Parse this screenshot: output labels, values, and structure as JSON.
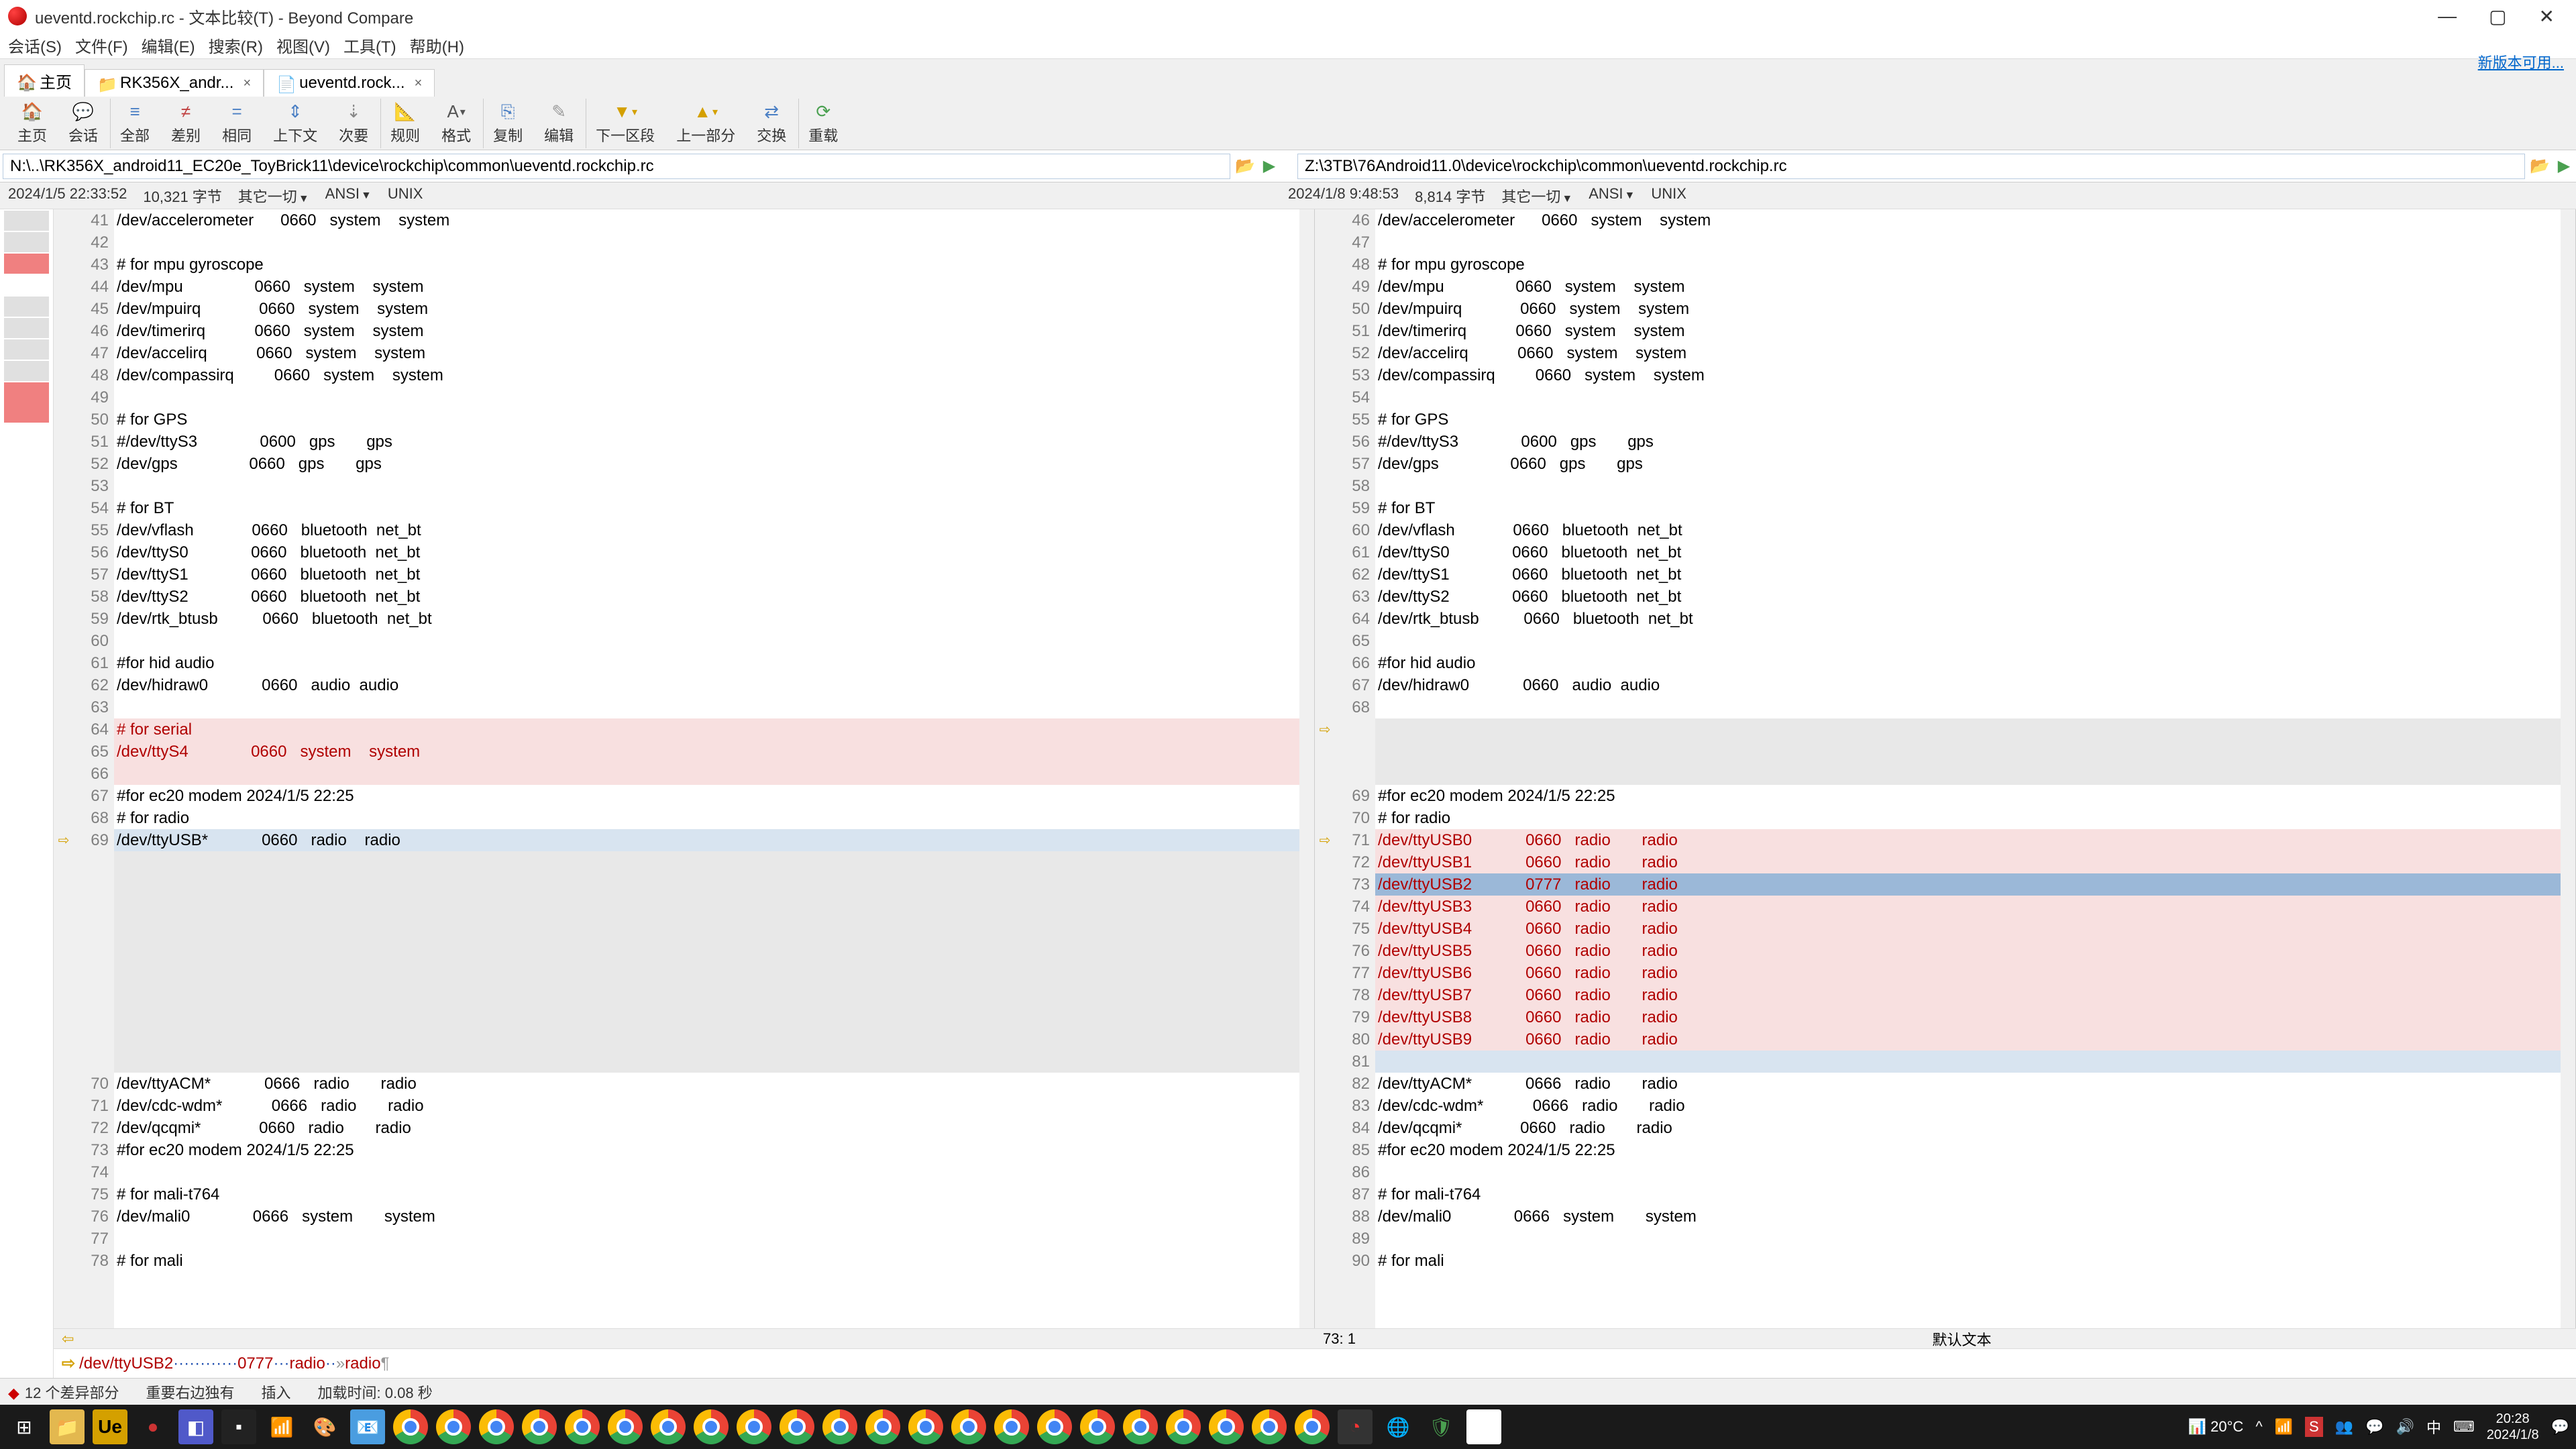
{
  "title": "ueventd.rockchip.rc - 文本比较(T) - Beyond Compare",
  "newversion": "新版本可用...",
  "menu": [
    "会话(S)",
    "文件(F)",
    "编辑(E)",
    "搜索(R)",
    "视图(V)",
    "工具(T)",
    "帮助(H)"
  ],
  "tabs": [
    {
      "label": "主页",
      "icon": "🏠"
    },
    {
      "label": "RK356X_andr...",
      "icon": "📁"
    },
    {
      "label": "ueventd.rock...",
      "icon": "📄"
    }
  ],
  "toolbar": [
    {
      "label": "主页",
      "icon": "🏠",
      "color": "#d4a000"
    },
    {
      "label": "会话",
      "icon": "💬",
      "color": "#d4a000"
    },
    {
      "label": "全部",
      "icon": "≡",
      "color": "#4a7fc4"
    },
    {
      "label": "差别",
      "icon": "≠",
      "color": "#c04040"
    },
    {
      "label": "相同",
      "icon": "=",
      "color": "#4a7fc4"
    },
    {
      "label": "上下文",
      "icon": "⇕",
      "color": "#4a7fc4"
    },
    {
      "label": "次要",
      "icon": "⇣",
      "color": "#888"
    },
    {
      "label": "规则",
      "icon": "📐",
      "color": "#d4a000"
    },
    {
      "label": "格式",
      "icon": "A",
      "color": "#555"
    },
    {
      "label": "复制",
      "icon": "⎘",
      "color": "#4a7fc4"
    },
    {
      "label": "编辑",
      "icon": "✎",
      "color": "#999"
    },
    {
      "label": "下一区段",
      "icon": "▼",
      "color": "#d4a000"
    },
    {
      "label": "上一部分",
      "icon": "▲",
      "color": "#d4a000"
    },
    {
      "label": "交换",
      "icon": "⇄",
      "color": "#4a7fc4"
    },
    {
      "label": "重载",
      "icon": "⟳",
      "color": "#4aa050"
    }
  ],
  "left_path": "N:\\..\\RK356X_android11_EC20e_ToyBrick11\\device\\rockchip\\common\\ueventd.rockchip.rc",
  "right_path": "Z:\\3TB\\76Android11.0\\device\\rockchip\\common\\ueventd.rockchip.rc",
  "left_status": {
    "time": "2024/1/5 22:33:52",
    "size": "10,321 字节",
    "all": "其它一切",
    "enc": "ANSI",
    "eol": "UNIX"
  },
  "right_status": {
    "time": "2024/1/8 9:48:53",
    "size": "8,814 字节",
    "all": "其它一切",
    "enc": "ANSI",
    "eol": "UNIX"
  },
  "left_lines": [
    {
      "n": 41,
      "t": "/dev/accelerometer      0660   system    system"
    },
    {
      "n": 42,
      "t": ""
    },
    {
      "n": 43,
      "t": "# for mpu gyroscope"
    },
    {
      "n": 44,
      "t": "/dev/mpu                0660   system    system"
    },
    {
      "n": 45,
      "t": "/dev/mpuirq             0660   system    system"
    },
    {
      "n": 46,
      "t": "/dev/timerirq           0660   system    system"
    },
    {
      "n": 47,
      "t": "/dev/accelirq           0660   system    system"
    },
    {
      "n": 48,
      "t": "/dev/compassirq         0660   system    system"
    },
    {
      "n": 49,
      "t": ""
    },
    {
      "n": 50,
      "t": "# for GPS"
    },
    {
      "n": 51,
      "t": "#/dev/ttyS3              0600   gps       gps"
    },
    {
      "n": 52,
      "t": "/dev/gps                0660   gps       gps"
    },
    {
      "n": 53,
      "t": ""
    },
    {
      "n": 54,
      "t": "# for BT"
    },
    {
      "n": 55,
      "t": "/dev/vflash             0660   bluetooth  net_bt"
    },
    {
      "n": 56,
      "t": "/dev/ttyS0              0660   bluetooth  net_bt"
    },
    {
      "n": 57,
      "t": "/dev/ttyS1              0660   bluetooth  net_bt"
    },
    {
      "n": 58,
      "t": "/dev/ttyS2              0660   bluetooth  net_bt"
    },
    {
      "n": 59,
      "t": "/dev/rtk_btusb          0660   bluetooth  net_bt"
    },
    {
      "n": 60,
      "t": ""
    },
    {
      "n": 61,
      "t": "#for hid audio"
    },
    {
      "n": 62,
      "t": "/dev/hidraw0            0660   audio  audio"
    },
    {
      "n": 63,
      "t": ""
    },
    {
      "n": 64,
      "t": "# for serial",
      "cls": "diff-red"
    },
    {
      "n": 65,
      "t": "/dev/ttyS4              0660   system    system",
      "cls": "diff-red"
    },
    {
      "n": 66,
      "t": "",
      "cls": "diff-red"
    },
    {
      "n": 67,
      "t": "#for ec20 modem 2024/1/5 22:25"
    },
    {
      "n": 68,
      "t": "# for radio"
    },
    {
      "n": 69,
      "t": "/dev/ttyUSB*            0660   radio    radio",
      "cls": "diff-blue",
      "marker": "⇨"
    },
    {
      "n": 0,
      "t": "",
      "cls": "diff-missing"
    },
    {
      "n": 0,
      "t": "",
      "cls": "diff-missing"
    },
    {
      "n": 0,
      "t": "",
      "cls": "diff-missing"
    },
    {
      "n": 0,
      "t": "",
      "cls": "diff-missing"
    },
    {
      "n": 0,
      "t": "",
      "cls": "diff-missing"
    },
    {
      "n": 0,
      "t": "",
      "cls": "diff-missing"
    },
    {
      "n": 0,
      "t": "",
      "cls": "diff-missing"
    },
    {
      "n": 0,
      "t": "",
      "cls": "diff-missing"
    },
    {
      "n": 0,
      "t": "",
      "cls": "diff-missing"
    },
    {
      "n": 0,
      "t": "",
      "cls": "diff-missing"
    },
    {
      "n": 70,
      "t": "/dev/ttyACM*            0666   radio       radio"
    },
    {
      "n": 71,
      "t": "/dev/cdc-wdm*           0666   radio       radio"
    },
    {
      "n": 72,
      "t": "/dev/qcqmi*             0660   radio       radio"
    },
    {
      "n": 73,
      "t": "#for ec20 modem 2024/1/5 22:25"
    },
    {
      "n": 74,
      "t": ""
    },
    {
      "n": 75,
      "t": "# for mali-t764"
    },
    {
      "n": 76,
      "t": "/dev/mali0              0666   system       system"
    },
    {
      "n": 77,
      "t": ""
    },
    {
      "n": 78,
      "t": "# for mali"
    }
  ],
  "right_lines": [
    {
      "n": 46,
      "t": "/dev/accelerometer      0660   system    system"
    },
    {
      "n": 47,
      "t": ""
    },
    {
      "n": 48,
      "t": "# for mpu gyroscope"
    },
    {
      "n": 49,
      "t": "/dev/mpu                0660   system    system"
    },
    {
      "n": 50,
      "t": "/dev/mpuirq             0660   system    system"
    },
    {
      "n": 51,
      "t": "/dev/timerirq           0660   system    system"
    },
    {
      "n": 52,
      "t": "/dev/accelirq           0660   system    system"
    },
    {
      "n": 53,
      "t": "/dev/compassirq         0660   system    system"
    },
    {
      "n": 54,
      "t": ""
    },
    {
      "n": 55,
      "t": "# for GPS"
    },
    {
      "n": 56,
      "t": "#/dev/ttyS3              0600   gps       gps"
    },
    {
      "n": 57,
      "t": "/dev/gps                0660   gps       gps"
    },
    {
      "n": 58,
      "t": ""
    },
    {
      "n": 59,
      "t": "# for BT"
    },
    {
      "n": 60,
      "t": "/dev/vflash             0660   bluetooth  net_bt"
    },
    {
      "n": 61,
      "t": "/dev/ttyS0              0660   bluetooth  net_bt"
    },
    {
      "n": 62,
      "t": "/dev/ttyS1              0660   bluetooth  net_bt"
    },
    {
      "n": 63,
      "t": "/dev/ttyS2              0660   bluetooth  net_bt"
    },
    {
      "n": 64,
      "t": "/dev/rtk_btusb          0660   bluetooth  net_bt"
    },
    {
      "n": 65,
      "t": ""
    },
    {
      "n": 66,
      "t": "#for hid audio"
    },
    {
      "n": 67,
      "t": "/dev/hidraw0            0660   audio  audio"
    },
    {
      "n": 68,
      "t": ""
    },
    {
      "n": 0,
      "t": "",
      "cls": "diff-missing",
      "marker": "⇨"
    },
    {
      "n": 0,
      "t": "",
      "cls": "diff-missing"
    },
    {
      "n": 0,
      "t": "",
      "cls": "diff-missing"
    },
    {
      "n": 69,
      "t": "#for ec20 modem 2024/1/5 22:25"
    },
    {
      "n": 70,
      "t": "# for radio"
    },
    {
      "n": 71,
      "t": "/dev/ttyUSB0            0660   radio       radio",
      "cls": "diff-red",
      "marker": "⇨"
    },
    {
      "n": 72,
      "t": "/dev/ttyUSB1            0660   radio       radio",
      "cls": "diff-red"
    },
    {
      "n": 73,
      "t": "/dev/ttyUSB2            0777   radio       radio",
      "cls": "diff-sel"
    },
    {
      "n": 74,
      "t": "/dev/ttyUSB3            0660   radio       radio",
      "cls": "diff-red"
    },
    {
      "n": 75,
      "t": "/dev/ttyUSB4            0660   radio       radio",
      "cls": "diff-red"
    },
    {
      "n": 76,
      "t": "/dev/ttyUSB5            0660   radio       radio",
      "cls": "diff-red"
    },
    {
      "n": 77,
      "t": "/dev/ttyUSB6            0660   radio       radio",
      "cls": "diff-red"
    },
    {
      "n": 78,
      "t": "/dev/ttyUSB7            0660   radio       radio",
      "cls": "diff-red"
    },
    {
      "n": 79,
      "t": "/dev/ttyUSB8            0660   radio       radio",
      "cls": "diff-red"
    },
    {
      "n": 80,
      "t": "/dev/ttyUSB9            0660   radio       radio",
      "cls": "diff-red"
    },
    {
      "n": 81,
      "t": "",
      "cls": "diff-blue"
    },
    {
      "n": 82,
      "t": "/dev/ttyACM*            0666   radio       radio"
    },
    {
      "n": 83,
      "t": "/dev/cdc-wdm*           0666   radio       radio"
    },
    {
      "n": 84,
      "t": "/dev/qcqmi*             0660   radio       radio"
    },
    {
      "n": 85,
      "t": "#for ec20 modem 2024/1/5 22:25"
    },
    {
      "n": 86,
      "t": ""
    },
    {
      "n": 87,
      "t": "# for mali-t764"
    },
    {
      "n": 88,
      "t": "/dev/mali0              0666   system       system"
    },
    {
      "n": 89,
      "t": ""
    },
    {
      "n": 90,
      "t": "# for mali"
    }
  ],
  "cursor": {
    "pos": "73: 1",
    "mode": "默认文本"
  },
  "diffline": "/dev/ttyUSB2············0777···radio·· »      radio¶",
  "footer": {
    "diff": "12 个差异部分",
    "side": "重要右边独有",
    "insert": "插入",
    "load": "加载时间: 0.08 秒"
  },
  "taskbar": {
    "temp": "20°C",
    "time": "20:28",
    "date": "2024/1/8"
  }
}
